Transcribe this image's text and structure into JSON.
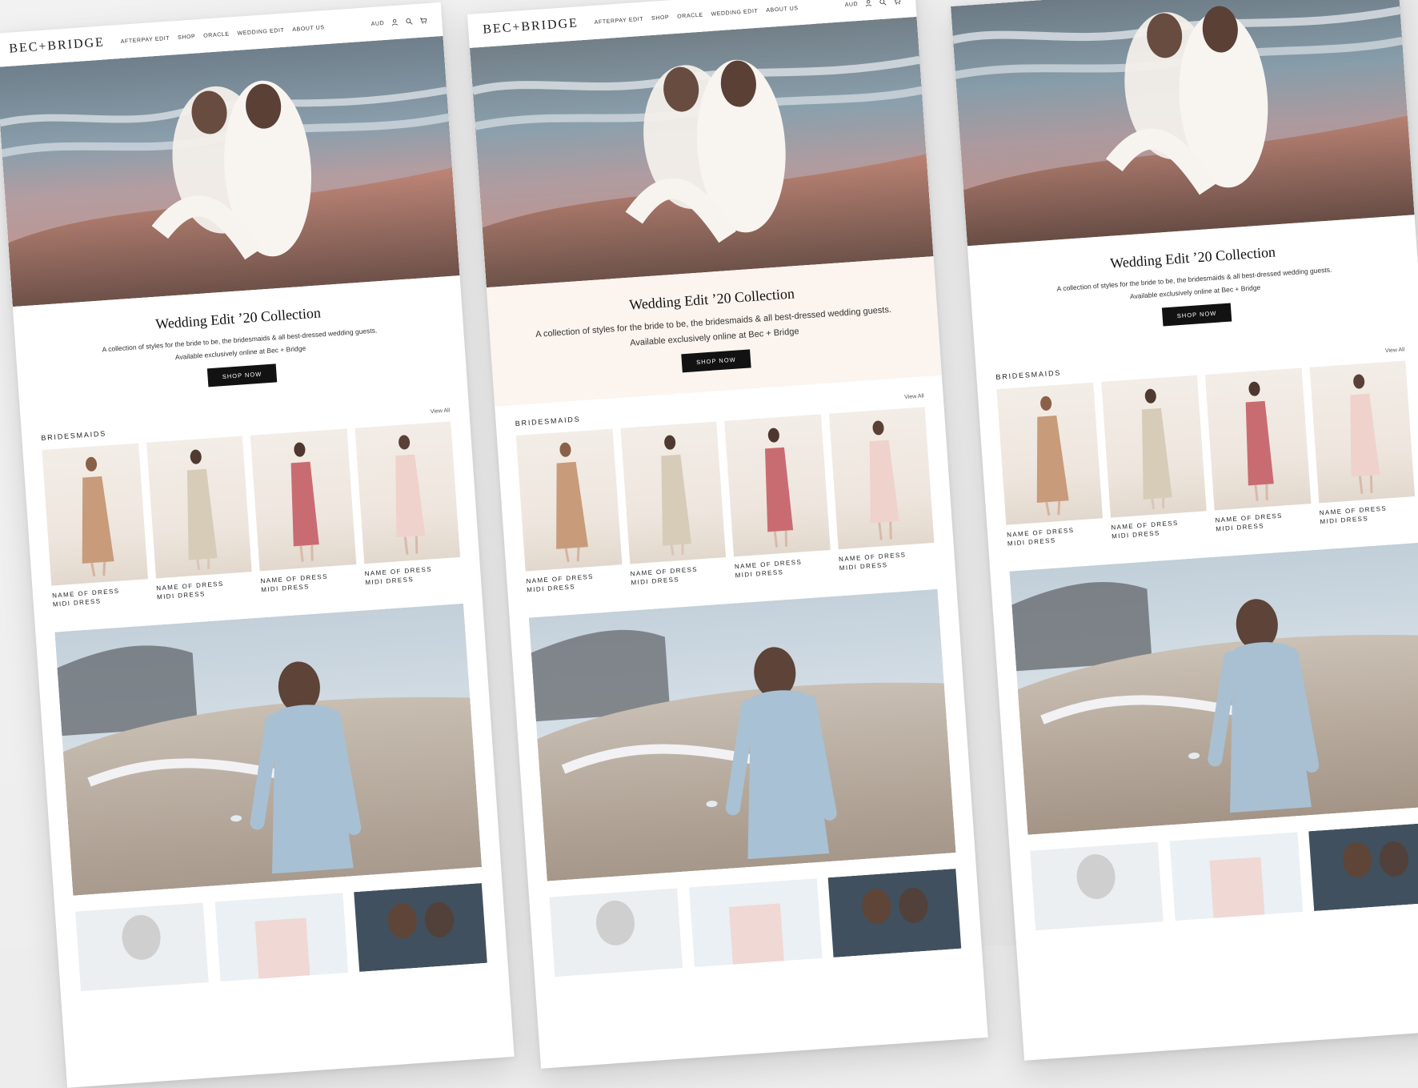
{
  "site": {
    "logo": "BEC+BRIDGE",
    "nav": [
      "AFTERPAY EDIT",
      "SHOP",
      "ORACLE",
      "WEDDING EDIT",
      "ABOUT US"
    ],
    "currency": "AUD",
    "icons": [
      "user-icon",
      "search-icon",
      "cart-icon"
    ]
  },
  "hero": {
    "title": "Wedding Edit ’20 Collection",
    "text": "A collection of styles for the bride to be, the bridesmaids & all best-dressed wedding guests.",
    "subtext": "Available exclusively online at Bec + Bridge",
    "cta": "SHOP NOW"
  },
  "bridesmaids": {
    "title": "BRIDESMAIDS",
    "view_all": "View All",
    "products": [
      {
        "name": "NAME OF DRESS",
        "subname": "MIDI DRESS",
        "color": "#c89b7b"
      },
      {
        "name": "NAME OF DRESS",
        "subname": "MIDI DRESS",
        "color": "#d7ccb8"
      },
      {
        "name": "NAME OF DRESS",
        "subname": "MIDI DRESS",
        "color": "#c96c72"
      },
      {
        "name": "NAME OF DRESS",
        "subname": "MIDI DRESS",
        "color": "#efd2cc"
      }
    ]
  }
}
